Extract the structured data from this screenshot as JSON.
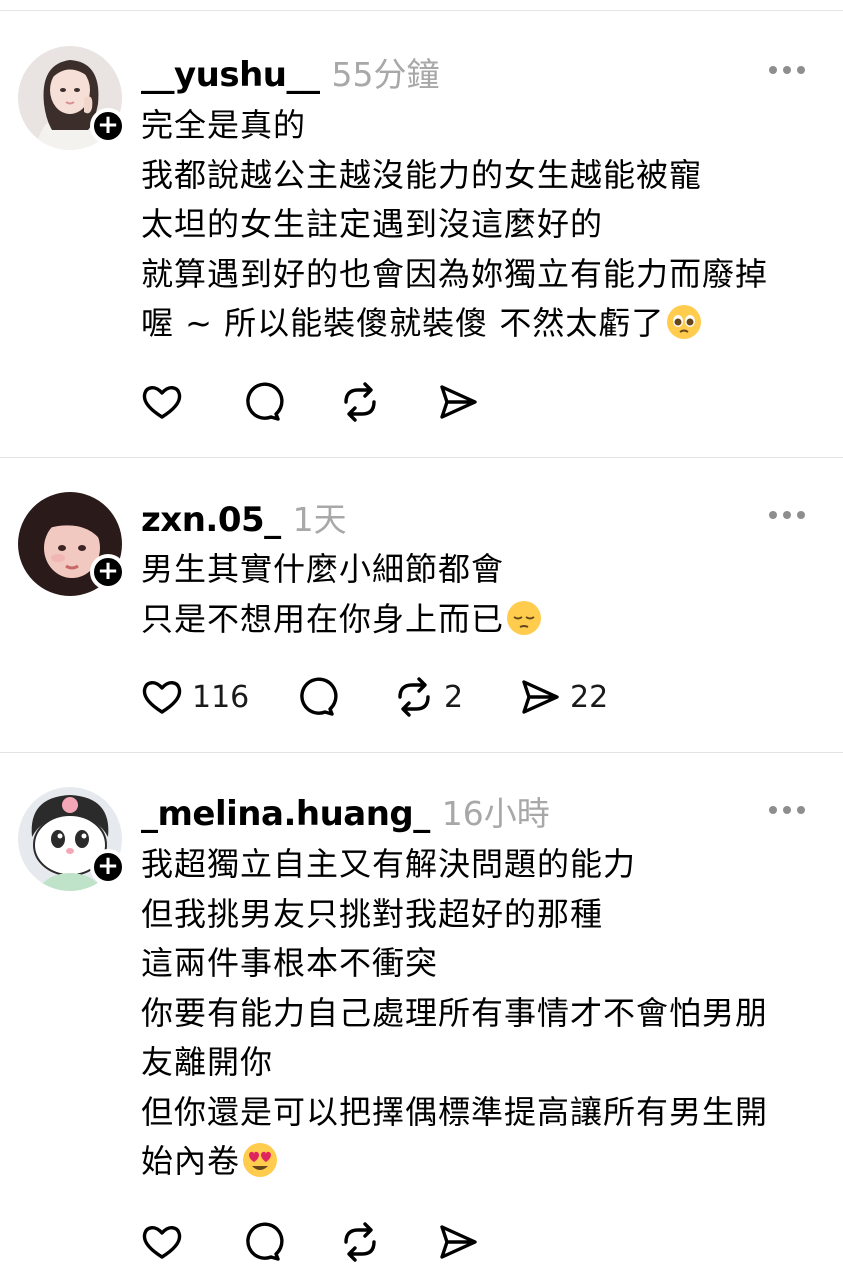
{
  "posts": [
    {
      "username": "__yushu__",
      "time": "55分鐘",
      "lines": [
        "完全是真的",
        "我都說越公主越沒能力的女生越能被寵",
        "太坦的女生註定遇到沒這麼好的",
        "就算遇到好的也會因為妳獨立有能力而廢掉",
        "喔 ~ 所以能裝傻就裝傻 不然太虧了"
      ],
      "emoji": "pleading-face-emoji",
      "counts": {
        "like": "",
        "reply": "",
        "repost": "",
        "share": ""
      }
    },
    {
      "username": "zxn.05_",
      "time": "1天",
      "lines": [
        "男生其實什麼小細節都會",
        "只是不想用在你身上而已"
      ],
      "emoji": "pensive-face-emoji",
      "counts": {
        "like": "116",
        "reply": "",
        "repost": "2",
        "share": "22"
      }
    },
    {
      "username": "_melina.huang_",
      "time": "16小時",
      "lines": [
        "我超獨立自主又有解決問題的能力",
        "但我挑男友只挑對我超好的那種",
        "這兩件事根本不衝突",
        "你要有能力自己處理所有事情才不會怕男朋",
        "友離開你",
        "但你還是可以把擇偶標準提高讓所有男生開",
        "始內卷"
      ],
      "emoji": "heart-eyes-emoji",
      "counts": {
        "like": "",
        "reply": "",
        "repost": "",
        "share": ""
      }
    }
  ],
  "colors": {
    "text": "#000000",
    "muted": "#a8a8a8",
    "divider": "#e3e3e3",
    "icon": "#000000"
  }
}
